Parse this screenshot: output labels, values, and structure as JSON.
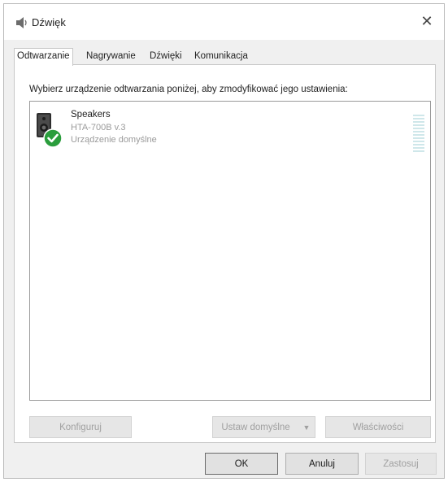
{
  "window": {
    "title": "Dźwięk",
    "title_icon": "speaker-icon",
    "close_glyph": "✕"
  },
  "tabs": [
    {
      "label": "Odtwarzanie",
      "active": true
    },
    {
      "label": "Nagrywanie",
      "active": false
    },
    {
      "label": "Dźwięki",
      "active": false
    },
    {
      "label": "Komunikacja",
      "active": false
    }
  ],
  "panel": {
    "instruction": "Wybierz urządzenie odtwarzania poniżej, aby zmodyfikować jego ustawienia:",
    "devices": [
      {
        "name": "Speakers",
        "model": "HTA-700B v.3",
        "status": "Urządzenie domyślne",
        "icon": "speaker-device-icon",
        "badge": "check-badge-icon",
        "level": 0
      }
    ],
    "buttons": {
      "configure": "Konfiguruj",
      "set_default": "Ustaw domyślne",
      "properties": "Właściwości"
    }
  },
  "footer": {
    "ok": "OK",
    "cancel": "Anuluj",
    "apply": "Zastosuj"
  },
  "colors": {
    "accent_check": "#2a9d3c",
    "meter": "#cfe7ea",
    "disabled_text": "#a0a0a0"
  }
}
